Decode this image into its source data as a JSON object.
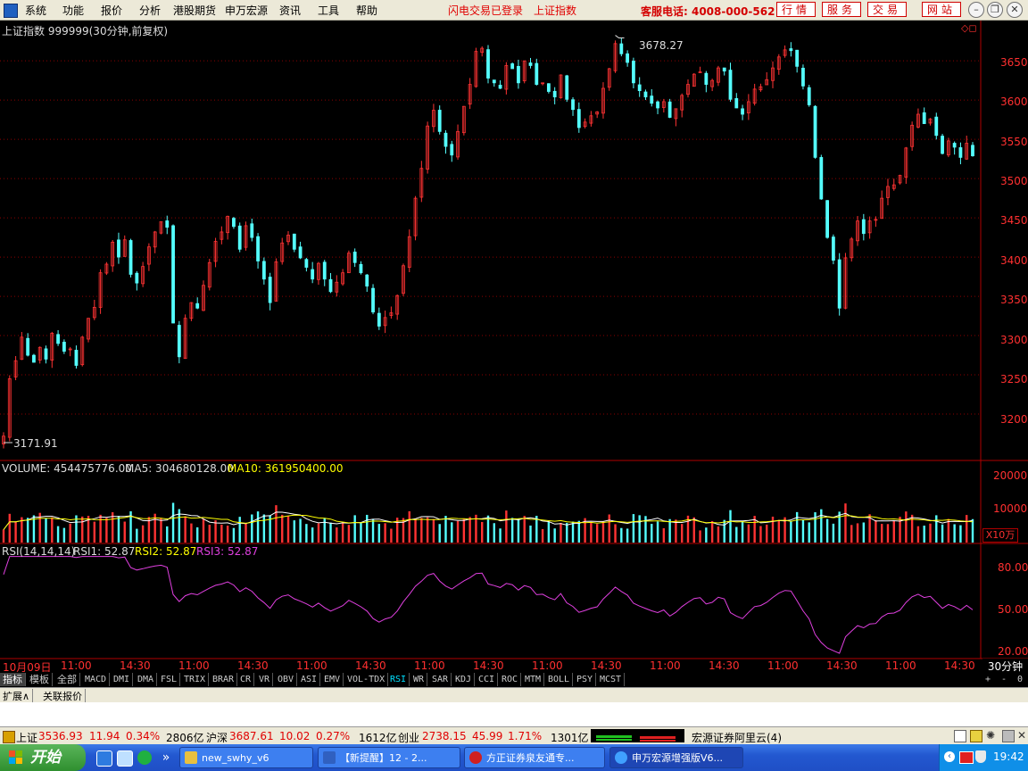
{
  "menu": {
    "items": [
      "系统",
      "功能",
      "报价",
      "分析",
      "港股期货",
      "申万宏源",
      "资讯",
      "工具",
      "帮助"
    ],
    "notice1": "闪电交易已登录",
    "notice2": "上证指数",
    "hotline": "客服电话: 4008-000-562",
    "buttons": [
      "行情",
      "服务",
      "交易",
      "网站"
    ]
  },
  "chart": {
    "title": "上证指数 999999(30分钟,前复权)",
    "high_label": "3678.27",
    "low_label": "3171.91",
    "price_axis": [
      "3650",
      "3600",
      "3550",
      "3500",
      "3450",
      "3400",
      "3350",
      "3300",
      "3250",
      "3200"
    ],
    "volume_label": "VOLUME: 454475776.00",
    "ma5_label": "MA5: 304680128.00",
    "ma10_label": "MA10: 361950400.00",
    "volume_axis": [
      "20000",
      "10000"
    ],
    "volume_unit": "X10万",
    "rsi_name": "RSI(14,14,14)",
    "rsi1_label": "RSI1: 52.87",
    "rsi2_label": "RSI2: 52.87",
    "rsi3_label": "RSI3: 52.87",
    "rsi_axis": [
      "80.00",
      "50.00",
      "20.00"
    ],
    "time_axis": [
      "10月09日",
      "11:00",
      "14:30",
      "11:00",
      "14:30",
      "11:00",
      "14:30",
      "11:00",
      "14:30",
      "11:00",
      "14:30",
      "11:00",
      "14:30",
      "11:00",
      "14:30",
      "11:00",
      "14:30"
    ],
    "period": "30分钟"
  },
  "colors": {
    "up": "#ff3333",
    "down": "#54ffff",
    "ma5": "#ffffff",
    "ma10": "#ffff00",
    "rsi": "#e040e0",
    "grid": "#8b0000",
    "axis": "#ff3030"
  },
  "indicator_tabs": [
    "指标",
    "模板",
    "全部",
    "MACD",
    "DMI",
    "DMA",
    "FSL",
    "TRIX",
    "BRAR",
    "CR",
    "VR",
    "OBV",
    "ASI",
    "EMV",
    "VOL-TDX",
    "RSI",
    "WR",
    "SAR",
    "KDJ",
    "CCI",
    "ROC",
    "MTM",
    "BOLL",
    "PSY",
    "MCST"
  ],
  "tab_controls": [
    "+",
    "-",
    "0"
  ],
  "bottom_tabs": [
    "扩展∧",
    "关联报价"
  ],
  "status": {
    "sh_name": "上证",
    "sh_value": "3536.93",
    "sh_change": "11.94",
    "sh_pct": "0.34%",
    "sh_amount": "2806亿",
    "hs_name": "沪深",
    "hs_value": "3687.61",
    "hs_change": "10.02",
    "hs_pct": "0.27%",
    "hs_amount": "1612亿",
    "cy_name": "创业",
    "cy_value": "2738.15",
    "cy_change": "45.99",
    "cy_pct": "1.71%",
    "cy_amount": "1301亿",
    "server": "宏源证券阿里云(4)"
  },
  "taskbar": {
    "start": "开始",
    "items": [
      "new_swhy_v6",
      "【新提醒】12 - 2...",
      "方正证券泉友通专...",
      "申万宏源增强版V6..."
    ],
    "clock": "19:42"
  },
  "chart_data": {
    "type": "candlestick",
    "price_ylim": [
      3150,
      3690
    ],
    "closes": [
      3171.9,
      3245,
      3268,
      3298,
      3275,
      3266,
      3285,
      3270,
      3303,
      3290,
      3280,
      3283,
      3262,
      3298,
      3322,
      3336,
      3380,
      3391,
      3419,
      3400,
      3422,
      3378,
      3367,
      3388,
      3413,
      3432,
      3445,
      3438,
      3316,
      3273,
      3322,
      3342,
      3335,
      3364,
      3393,
      3420,
      3432,
      3452,
      3439,
      3410,
      3440,
      3425,
      3395,
      3372,
      3342,
      3394,
      3418,
      3428,
      3410,
      3399,
      3387,
      3372,
      3392,
      3372,
      3356,
      3368,
      3380,
      3405,
      3393,
      3380,
      3363,
      3330,
      3312,
      3323,
      3329,
      3351,
      3389,
      3426,
      3475,
      3513,
      3567,
      3587,
      3560,
      3541,
      3530,
      3560,
      3592,
      3620,
      3662,
      3666,
      3628,
      3622,
      3615,
      3644,
      3640,
      3622,
      3650,
      3644,
      3620,
      3622,
      3611,
      3604,
      3632,
      3601,
      3588,
      3565,
      3572,
      3580,
      3585,
      3615,
      3640,
      3672,
      3659,
      3648,
      3622,
      3612,
      3604,
      3596,
      3590,
      3598,
      3578,
      3589,
      3606,
      3620,
      3633,
      3636,
      3620,
      3625,
      3641,
      3637,
      3601,
      3590,
      3582,
      3598,
      3614,
      3617,
      3626,
      3641,
      3655,
      3664,
      3663,
      3643,
      3618,
      3594,
      3527,
      3474,
      3425,
      3396,
      3335,
      3399,
      3423,
      3446,
      3430,
      3446,
      3448,
      3475,
      3490,
      3492,
      3504,
      3539,
      3568,
      3582,
      3570,
      3576,
      3555,
      3532,
      3548,
      3540,
      3527,
      3545,
      3529
    ]
  }
}
